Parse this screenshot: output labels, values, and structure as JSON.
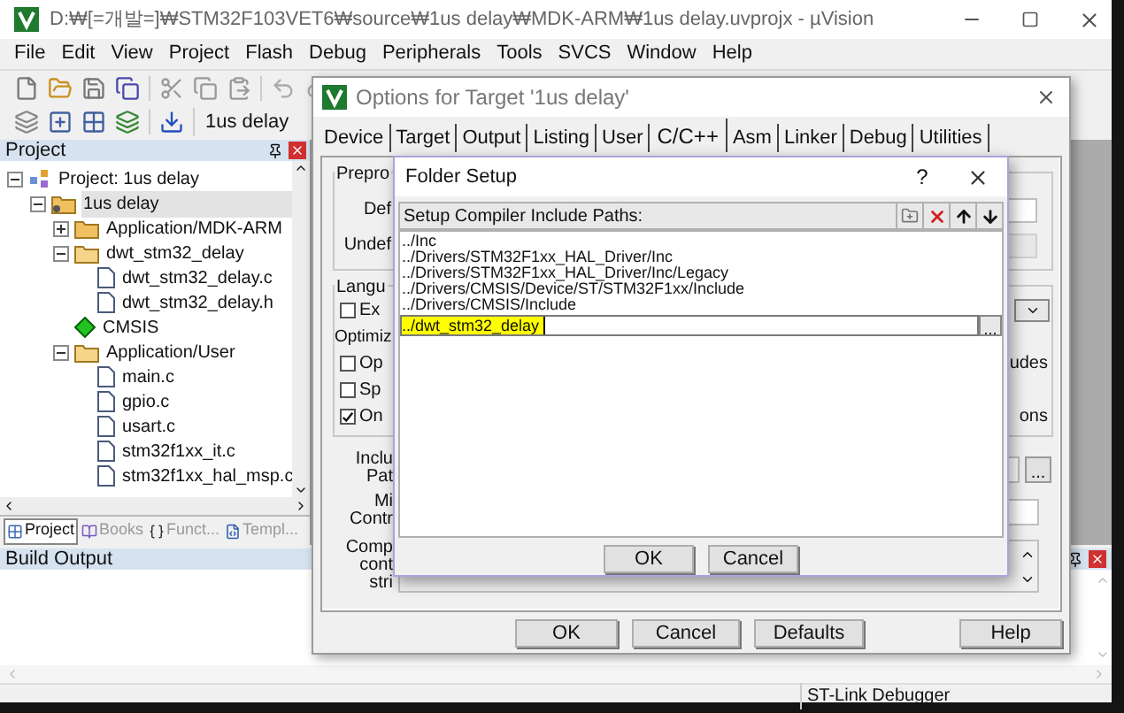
{
  "window": {
    "title": "D:₩[=개발=]₩STM32F103VET6₩source₩1us delay₩MDK-ARM₩1us delay.uvprojx - µVision"
  },
  "menu": [
    "File",
    "Edit",
    "View",
    "Project",
    "Flash",
    "Debug",
    "Peripherals",
    "Tools",
    "SVCS",
    "Window",
    "Help"
  ],
  "toolbar": {
    "target": "1us delay"
  },
  "project_panel": {
    "title": "Project",
    "tree": [
      {
        "label": "Project: 1us delay",
        "kind": "project",
        "selected": false,
        "expanded": true,
        "children": [
          {
            "label": "1us delay",
            "kind": "target",
            "selected": true,
            "expanded": true,
            "children": [
              {
                "label": "Application/MDK-ARM",
                "kind": "group",
                "selected": false,
                "expanded": false
              },
              {
                "label": "dwt_stm32_delay",
                "kind": "group",
                "selected": false,
                "expanded": true,
                "children": [
                  {
                    "label": "dwt_stm32_delay.c",
                    "kind": "file",
                    "selected": false
                  },
                  {
                    "label": "dwt_stm32_delay.h",
                    "kind": "file",
                    "selected": false
                  }
                ]
              },
              {
                "label": "CMSIS",
                "kind": "component",
                "selected": false
              },
              {
                "label": "Application/User",
                "kind": "group",
                "selected": false,
                "expanded": true,
                "children": [
                  {
                    "label": "main.c",
                    "kind": "file",
                    "selected": false
                  },
                  {
                    "label": "gpio.c",
                    "kind": "file",
                    "selected": false
                  },
                  {
                    "label": "usart.c",
                    "kind": "file",
                    "selected": false
                  },
                  {
                    "label": "stm32f1xx_it.c",
                    "kind": "file",
                    "selected": false
                  },
                  {
                    "label": "stm32f1xx_hal_msp.c",
                    "kind": "file",
                    "selected": false
                  }
                ]
              }
            ]
          }
        ]
      }
    ],
    "tabs": [
      {
        "label": "Project",
        "kind": "project",
        "selected": true
      },
      {
        "label": "Books",
        "kind": "books",
        "selected": false
      },
      {
        "label": "Funct...",
        "kind": "functions",
        "selected": false
      },
      {
        "label": "Templ...",
        "kind": "templates",
        "selected": false
      }
    ]
  },
  "build_output": {
    "title": "Build Output"
  },
  "status_bar": {
    "debugger": "ST-Link Debugger"
  },
  "options_dialog": {
    "title": "Options for Target '1us delay'",
    "tabs": [
      {
        "label": "Device",
        "selected": false
      },
      {
        "label": "Target",
        "selected": false
      },
      {
        "label": "Output",
        "selected": false
      },
      {
        "label": "Listing",
        "selected": false
      },
      {
        "label": "User",
        "selected": false
      },
      {
        "label": "C/C++",
        "selected": true
      },
      {
        "label": "Asm",
        "selected": false
      },
      {
        "label": "Linker",
        "selected": false
      },
      {
        "label": "Debug",
        "selected": false
      },
      {
        "label": "Utilities",
        "selected": false
      }
    ],
    "preprocessor": {
      "legend": "Prepro",
      "define": "Def",
      "undefine": "Undef"
    },
    "language": {
      "legend": "Langu",
      "execute_only": {
        "label": "Ex",
        "checked": false
      },
      "optimization": "Optimiz",
      "options": [
        {
          "label": "Op",
          "checked": false
        },
        {
          "label": "Sp",
          "checked": false
        },
        {
          "label": "On",
          "checked": true
        }
      ],
      "right_texts": [
        "udes",
        "ons"
      ]
    },
    "include_paths": [
      "Inclu",
      "Pat"
    ],
    "misc_controls": [
      "Mi",
      "Contr"
    ],
    "compiler_string": [
      "Comp",
      "cont",
      "stri"
    ],
    "browse": "...",
    "buttons": [
      "OK",
      "Cancel",
      "Defaults",
      "Help"
    ]
  },
  "folder_dialog": {
    "title": "Folder Setup",
    "help": "?",
    "list_label": "Setup Compiler Include Paths:",
    "paths": [
      {
        "text": "../Inc",
        "editing": false
      },
      {
        "text": "../Drivers/STM32F1xx_HAL_Driver/Inc",
        "editing": false
      },
      {
        "text": "../Drivers/STM32F1xx_HAL_Driver/Inc/Legacy",
        "editing": false
      },
      {
        "text": "../Drivers/CMSIS/Device/ST/STM32F1xx/Include",
        "editing": false
      },
      {
        "text": "../Drivers/CMSIS/Include",
        "editing": false
      },
      {
        "text": "../dwt_stm32_delay",
        "editing": true
      }
    ],
    "browse": "...",
    "buttons": [
      "OK",
      "Cancel"
    ]
  }
}
